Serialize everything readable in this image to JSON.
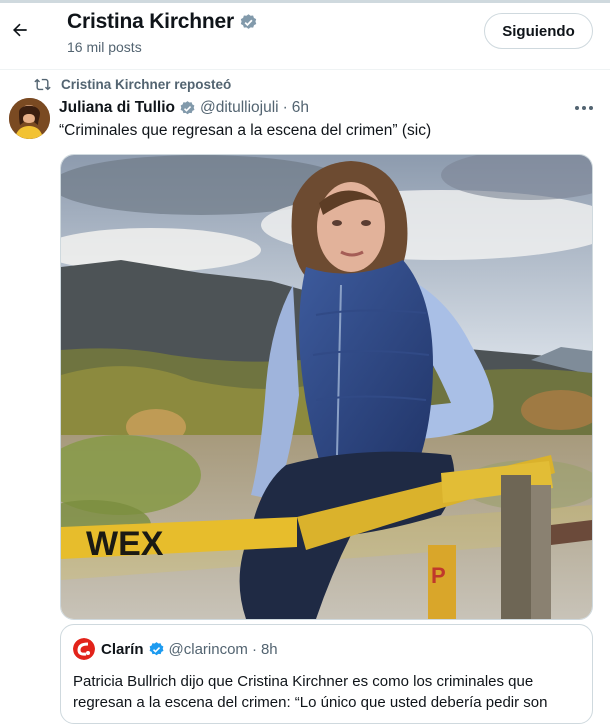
{
  "header": {
    "name": "Cristina Kirchner",
    "posts": "16 mil posts",
    "follow_label": "Siguiendo"
  },
  "repost": {
    "text": "Cristina Kirchner reposteó"
  },
  "tweet": {
    "author_name": "Juliana di Tullio",
    "handle": "@ditulliojuli",
    "dot": "·",
    "time": "6h",
    "text": "“Criminales que regresan a la escena del crimen” (sic)",
    "media_sign_text": "WEX",
    "media_sign_text_2": "P"
  },
  "quote": {
    "name": "Clarín",
    "handle": "@clarincom",
    "dot": "·",
    "time": "8h",
    "text": "Patricia Bullrich dijo que Cristina Kirchner es como los criminales que regresan a la escena del crimen: “Lo único que usted debería pedir son"
  },
  "icons": [
    "back-arrow-icon",
    "verified-badge-icon",
    "repost-icon",
    "more-options-icon",
    "clarin-logo-icon"
  ],
  "colors": {
    "verified": "#1d9bf0",
    "secondary_text": "#536471",
    "border": "#cfd9de",
    "clarin_red": "#e2231a"
  }
}
